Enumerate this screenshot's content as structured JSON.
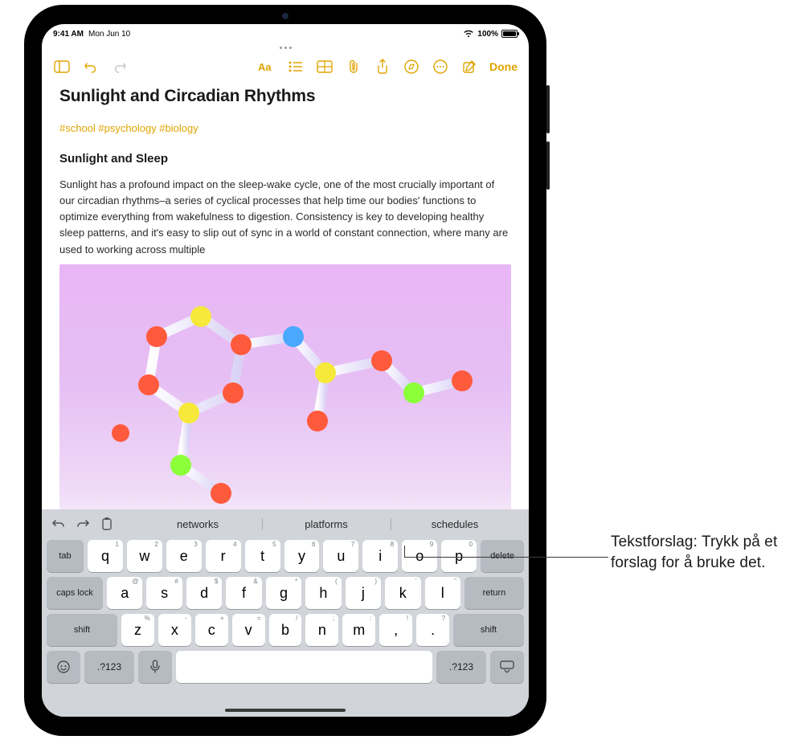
{
  "statusbar": {
    "time": "9:41 AM",
    "date": "Mon Jun 10",
    "battery_pct": "100%"
  },
  "toolbar": {
    "icons": {
      "sidebar": "sidebar-icon",
      "undo": "undo-icon",
      "redo": "redo-icon",
      "format": "format-icon",
      "list": "list-icon",
      "table": "table-icon",
      "attach": "attach-icon",
      "share": "share-icon",
      "markup": "markup-icon",
      "more": "more-icon",
      "compose": "compose-icon"
    },
    "done_label": "Done"
  },
  "note": {
    "title": "Sunlight and Circadian Rhythms",
    "tags": "#school #psychology #biology",
    "heading": "Sunlight and Sleep",
    "paragraph": "Sunlight has a profound impact on the sleep-wake cycle, one of the most crucially important of our circadian rhythms–a series of cyclical processes that help time our bodies' functions to optimize everything from wakefulness to digestion. Consistency is key to developing healthy sleep patterns, and it's easy to slip out of sync in a world of constant connection, where many are used to working across multiple",
    "image_alt": "molecule-3d"
  },
  "keyboard": {
    "bar_icons": {
      "undo": "undo-icon",
      "redo": "redo-icon",
      "clipboard": "clipboard-icon"
    },
    "suggestions": [
      "networks",
      "platforms",
      "schedules"
    ],
    "row1": [
      {
        "main": "q",
        "alt": "1"
      },
      {
        "main": "w",
        "alt": "2"
      },
      {
        "main": "e",
        "alt": "3"
      },
      {
        "main": "r",
        "alt": "4"
      },
      {
        "main": "t",
        "alt": "5"
      },
      {
        "main": "y",
        "alt": "6"
      },
      {
        "main": "u",
        "alt": "7"
      },
      {
        "main": "i",
        "alt": "8"
      },
      {
        "main": "o",
        "alt": "9"
      },
      {
        "main": "p",
        "alt": "0"
      }
    ],
    "tab": "tab",
    "delete": "delete",
    "row2": [
      {
        "main": "a",
        "alt": "@"
      },
      {
        "main": "s",
        "alt": "#"
      },
      {
        "main": "d",
        "alt": "$"
      },
      {
        "main": "f",
        "alt": "&"
      },
      {
        "main": "g",
        "alt": "*"
      },
      {
        "main": "h",
        "alt": "("
      },
      {
        "main": "j",
        "alt": ")"
      },
      {
        "main": "k",
        "alt": "'"
      },
      {
        "main": "l",
        "alt": "\""
      }
    ],
    "caps": "caps lock",
    "return": "return",
    "row3": [
      {
        "main": "z",
        "alt": "%"
      },
      {
        "main": "x",
        "alt": "-"
      },
      {
        "main": "c",
        "alt": "+"
      },
      {
        "main": "v",
        "alt": "="
      },
      {
        "main": "b",
        "alt": "/"
      },
      {
        "main": "n",
        "alt": ";"
      },
      {
        "main": "m",
        "alt": ":"
      },
      {
        "main": ",",
        "alt": "!"
      },
      {
        "main": ".",
        "alt": "?"
      }
    ],
    "shift": "shift",
    "numswitch": ".?123",
    "icons": {
      "globe": "globe-emoji-icon",
      "mic": "mic-icon",
      "dismiss": "dismiss-keyboard-icon"
    }
  },
  "callout": {
    "text": "Tekstforslag: Trykk på et forslag for å bruke det."
  },
  "colors": {
    "accent": "#e0a400",
    "keyboard_bg": "#d1d4d9",
    "image_bg": "#e8b6f5"
  }
}
